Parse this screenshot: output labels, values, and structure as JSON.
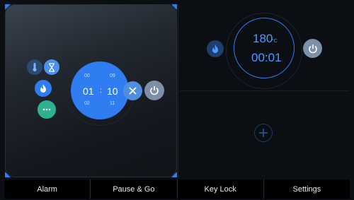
{
  "colors": {
    "accent": "#2f7df0",
    "green": "#2fb090",
    "power": "#7d90a8"
  },
  "left_timer": {
    "hours_above": "00",
    "hours": "01",
    "hours_below": "02",
    "separator": ":",
    "minutes_above": "09",
    "minutes": "10",
    "minutes_below": "11"
  },
  "right_status": {
    "temperature": "180",
    "temperature_unit": "°C",
    "time": "00:01"
  },
  "icons": {
    "thermometer": "thermometer-icon",
    "hourglass": "hourglass-icon",
    "flame": "flame-icon",
    "more": "more-dots-icon",
    "close": "close-icon",
    "power": "power-icon",
    "add": "plus-icon"
  },
  "bottom_bar": {
    "items": [
      {
        "label": "Alarm"
      },
      {
        "label": "Pause & Go"
      },
      {
        "label": "Key Lock"
      },
      {
        "label": "Settings"
      }
    ]
  }
}
